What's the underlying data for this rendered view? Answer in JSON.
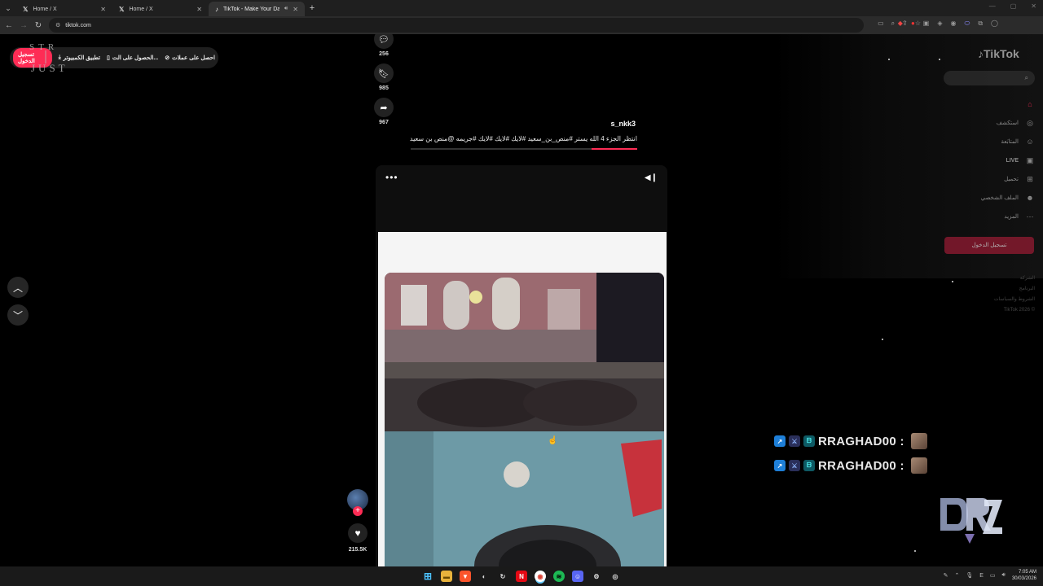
{
  "browser": {
    "tabs": [
      {
        "label": "Home / X",
        "icon": "x-logo-icon",
        "active": false
      },
      {
        "label": "Home / X",
        "icon": "x-logo-icon",
        "active": false
      },
      {
        "label": "TikTok - Make Your Day",
        "icon": "tiktok-logo-icon",
        "active": true
      }
    ],
    "url": "tiktok.com"
  },
  "tiktok_top": {
    "login": "تسجيل الدخول",
    "desktop_app": "تطبيق الكمبيوتر",
    "get_app": "الحصول على الت...",
    "get_coins": "احصل على عملات"
  },
  "watermark_text": "STR JUST",
  "actions": {
    "comments": "256",
    "saves": "985",
    "shares": "967",
    "likes": "215.5K"
  },
  "post": {
    "author": "s_nkk3",
    "caption": "انتظر الجزء 4 الله يستر #منص_بن_سعيد #لايك #لايك #لايك #جريمه @منص بن سعيد",
    "progress": 0.2
  },
  "sidebar": {
    "logo": "TikTok",
    "items": [
      {
        "label": "",
        "icon": "home-icon"
      },
      {
        "label": "استكشف",
        "icon": "compass-icon"
      },
      {
        "label": "المتابَعة",
        "icon": "following-icon"
      },
      {
        "label": "LIVE",
        "icon": "live-icon"
      },
      {
        "label": "تحميل",
        "icon": "upload-icon"
      },
      {
        "label": "الملف الشخصي",
        "icon": "profile-icon"
      },
      {
        "label": "المزيد",
        "icon": "more-icon"
      }
    ],
    "login": "تسجيل الدخول",
    "footer": [
      "الشركة",
      "البرنامج",
      "الشروط والسياسات",
      "TikTok 2026 ©"
    ]
  },
  "chat": [
    {
      "name": "RRAGHAD00 :"
    },
    {
      "name": "RRAGHAD00 :"
    }
  ],
  "taskbar": {
    "time": "7:05 AM",
    "date": "30/03/2026",
    "lang": "E"
  }
}
